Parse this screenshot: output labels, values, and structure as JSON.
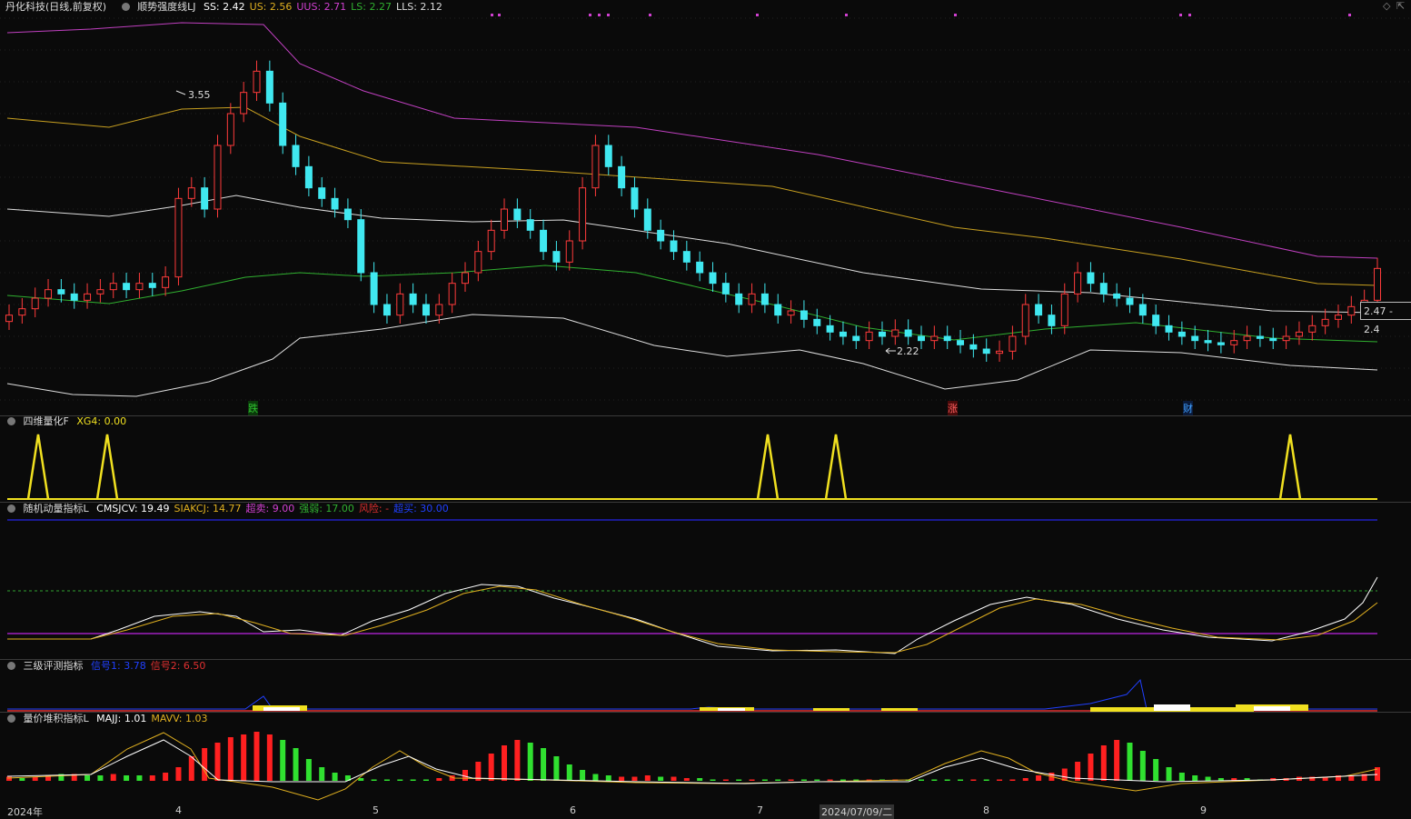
{
  "main": {
    "stock_name": "丹化科技(日线,前复权)",
    "indicator_name": "顺势强度线LJ",
    "values": [
      {
        "label": "SS: 2.42",
        "color": "#ffffff"
      },
      {
        "label": "US: 2.56",
        "color": "#e0b020"
      },
      {
        "label": "UUS: 2.71",
        "color": "#d040d0"
      },
      {
        "label": "LS: 2.27",
        "color": "#30b030"
      },
      {
        "label": "LLS: 2.12",
        "color": "#dddddd"
      }
    ],
    "high_label": "3.55",
    "low_label": "2.22",
    "price_box": "2.47 - 2.4",
    "markers": [
      {
        "text": "跌",
        "color": "#30c030",
        "bg": "#0a3a0a"
      },
      {
        "text": "涨",
        "color": "#ff6060",
        "bg": "#4a0a0a"
      },
      {
        "text": "财",
        "color": "#40a0ff",
        "bg": "#0a1a3a"
      }
    ],
    "ctrl_icons": [
      "diamond-icon",
      "expand-icon"
    ]
  },
  "panel2": {
    "name": "四维量化F",
    "values": [
      {
        "label": "XG4: 0.00",
        "color": "#f0e020"
      }
    ]
  },
  "panel3": {
    "name": "随机动量指标L",
    "values": [
      {
        "label": "CMSJCV: 19.49",
        "color": "#ffffff"
      },
      {
        "label": "SIAKCJ: 14.77",
        "color": "#e0b020"
      },
      {
        "label": "超卖: 9.00",
        "color": "#d040d0"
      },
      {
        "label": "强弱: 17.00",
        "color": "#30b030"
      },
      {
        "label": "风险: -",
        "color": "#e03030"
      },
      {
        "label": "超买: 30.00",
        "color": "#2040ff"
      }
    ]
  },
  "panel4": {
    "name": "三级评测指标",
    "values": [
      {
        "label": "信号1: 3.78",
        "color": "#2040ff"
      },
      {
        "label": "信号2: 6.50",
        "color": "#e03030"
      }
    ]
  },
  "panel5": {
    "name": "量价堆积指标L",
    "values": [
      {
        "label": "MAJJ: 1.01",
        "color": "#ffffff"
      },
      {
        "label": "MAVV: 1.03",
        "color": "#e0b020"
      }
    ]
  },
  "axis": {
    "labels": [
      "2024年",
      "4",
      "5",
      "6",
      "7",
      "2024/07/09/二",
      "8",
      "9"
    ]
  },
  "chart_data": {
    "type": "candlestick",
    "title": "丹化科技(日线,前复权)",
    "close_series": [
      2.4,
      2.43,
      2.48,
      2.52,
      2.5,
      2.47,
      2.5,
      2.52,
      2.55,
      2.52,
      2.55,
      2.53,
      2.58,
      2.95,
      3.0,
      2.9,
      3.2,
      3.35,
      3.45,
      3.55,
      3.4,
      3.2,
      3.1,
      3.0,
      2.95,
      2.9,
      2.85,
      2.6,
      2.45,
      2.4,
      2.5,
      2.45,
      2.4,
      2.45,
      2.55,
      2.6,
      2.7,
      2.8,
      2.9,
      2.85,
      2.8,
      2.7,
      2.65,
      2.75,
      3.0,
      3.2,
      3.1,
      3.0,
      2.9,
      2.8,
      2.75,
      2.7,
      2.65,
      2.6,
      2.55,
      2.5,
      2.45,
      2.5,
      2.45,
      2.4,
      2.42,
      2.38,
      2.35,
      2.32,
      2.3,
      2.28,
      2.32,
      2.3,
      2.33,
      2.3,
      2.28,
      2.3,
      2.28,
      2.26,
      2.24,
      2.22,
      2.23,
      2.3,
      2.45,
      2.4,
      2.35,
      2.5,
      2.6,
      2.55,
      2.5,
      2.48,
      2.45,
      2.4,
      2.35,
      2.32,
      2.3,
      2.28,
      2.27,
      2.26,
      2.28,
      2.3,
      2.29,
      2.28,
      2.3,
      2.32,
      2.35,
      2.38,
      2.4,
      2.44,
      2.47,
      2.62
    ],
    "high": 3.55,
    "low": 2.22
  }
}
